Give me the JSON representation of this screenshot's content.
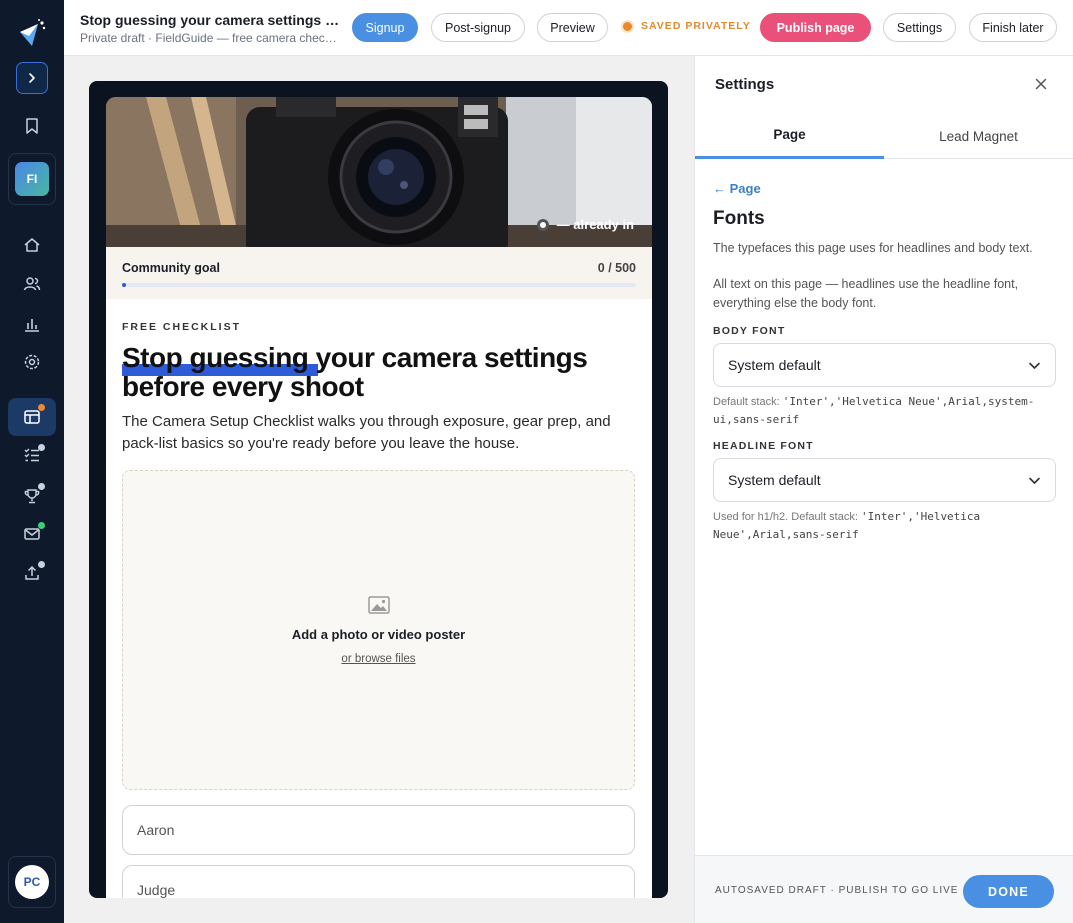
{
  "sidebar": {
    "workspace_initials": "FI",
    "user_initials": "PC"
  },
  "topbar": {
    "title": "Stop guessing your camera settings before every shoot",
    "subtitle": "Private draft · FieldGuide — free camera checklist",
    "tabs": {
      "signup": "Signup",
      "post_signup": "Post-signup",
      "preview": "Preview"
    },
    "saved_status": "SAVED PRIVATELY",
    "publish_label": "Publish page",
    "settings_label": "Settings",
    "finish_later_label": "Finish later"
  },
  "preview": {
    "hero_caption": "— already in",
    "goal": {
      "label": "Community goal",
      "count": "0 / 500",
      "progress": 0
    },
    "eyebrow": "FREE CHECKLIST",
    "headline_part1": "Stop guessing",
    "headline_part2": " your camera settings before every shoot",
    "description": "The Camera Setup Checklist walks you through exposure, gear prep, and pack-list basics so you're ready before you leave the house.",
    "dropzone": {
      "title": "Add a photo or video poster",
      "link": "or browse files"
    },
    "fields": {
      "first_name": "Aaron",
      "last_name": "Judge"
    }
  },
  "panel": {
    "title": "Settings",
    "tabs": {
      "page": "Page",
      "lead_magnet": "Lead Magnet"
    },
    "back_label": "← Page",
    "section_title": "Fonts",
    "section_sub": "The typefaces this page uses for headlines and body text.",
    "section_info": "All text on this page — headlines use the headline font, everything else the body font.",
    "body_font": {
      "label": "BODY FONT",
      "value": "System default",
      "hint_prefix": "Default stack: ",
      "hint_stack": "'Inter','Helvetica Neue',Arial,system-ui,sans-serif"
    },
    "headline_font": {
      "label": "HEADLINE FONT",
      "value": "System default",
      "hint_prefix": "Used for h1/h2. Default stack: ",
      "hint_stack": "'Inter','Helvetica Neue',Arial,sans-serif"
    },
    "footer_text": "AUTOSAVED DRAFT · PUBLISH TO GO LIVE",
    "done_label": "DONE"
  },
  "colors": {
    "sidebar_bg": "#0e1a2b",
    "primary": "#4a90e2",
    "publish": "#e9507a",
    "saved": "#e08a2e",
    "highlight": "#2e5bd8"
  },
  "icons": [
    "logo-icon",
    "chevron-right-icon",
    "bookmark-icon",
    "home-icon",
    "users-icon",
    "chart-icon",
    "gear-icon",
    "layout-icon",
    "checklist-icon",
    "trophy-icon",
    "mail-icon",
    "upload-icon",
    "image-icon",
    "close-icon",
    "chevron-down-icon"
  ]
}
